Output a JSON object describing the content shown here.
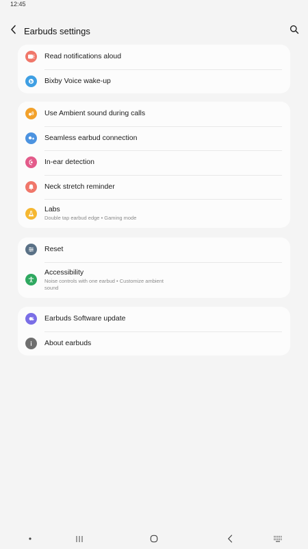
{
  "status_bar": {
    "time": "12:45"
  },
  "app_bar": {
    "title": "Earbuds settings",
    "back_icon": "chevron-left-icon",
    "search_icon": "search-icon"
  },
  "groups": [
    {
      "items": [
        {
          "label": "Read notifications aloud",
          "icon": "notification-speak-icon",
          "color": "#f0776a"
        },
        {
          "label": "Bixby Voice wake-up",
          "icon": "bixby-icon",
          "color": "#3f9fe3"
        }
      ]
    },
    {
      "items": [
        {
          "label": "Use Ambient sound during calls",
          "icon": "ambient-sound-icon",
          "color": "#f2a12b"
        },
        {
          "label": "Seamless earbud connection",
          "icon": "seamless-connection-icon",
          "color": "#4c93e0"
        },
        {
          "label": "In-ear detection",
          "icon": "in-ear-detection-icon",
          "color": "#e35b8a"
        },
        {
          "label": "Neck stretch reminder",
          "icon": "bell-icon",
          "color": "#f0776a"
        },
        {
          "label": "Labs",
          "sub": "Double tap earbud edge • Gaming mode",
          "icon": "flask-icon",
          "color": "#f5b731"
        }
      ]
    },
    {
      "items": [
        {
          "label": "Reset",
          "icon": "reset-icon",
          "color": "#5a7186"
        },
        {
          "label": "Accessibility",
          "sub": "Noise controls with one earbud • Customize ambient sound",
          "icon": "accessibility-icon",
          "color": "#2fa860"
        }
      ]
    },
    {
      "items": [
        {
          "label": "Earbuds Software update",
          "icon": "software-update-icon",
          "color": "#7a6ee6"
        },
        {
          "label": "About earbuds",
          "icon": "info-icon",
          "color": "#6f6f6f"
        }
      ]
    }
  ],
  "nav_bar": {
    "items": [
      "dot-icon",
      "recent-apps-icon",
      "home-icon",
      "back-icon",
      "keyboard-icon"
    ]
  }
}
